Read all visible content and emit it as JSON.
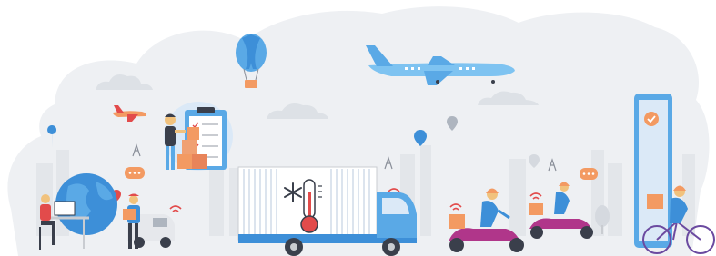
{
  "scene": {
    "kind": "logistics-illustration",
    "palette": {
      "background": "#ffffff",
      "cloud_bg": "#eef0f3",
      "skyline": "#e3e6ea",
      "primary_blue": "#3d8fd8",
      "light_blue": "#5aa9e6",
      "sky_blue": "#7ec3f1",
      "magenta": "#b0368a",
      "purple": "#6b4aa0",
      "orange": "#f39a62",
      "accent_red": "#e24b4b",
      "grey": "#c9ccd1",
      "dark": "#3a3f4b"
    },
    "icons": [
      "hot-air-balloon-icon",
      "airplane-icon",
      "small-airplane-icon",
      "location-pin-icon",
      "wifi-signal-icon",
      "radio-tower-icon",
      "chat-bubble-icon",
      "snowflake-icon",
      "thermometer-icon",
      "checkmark-icon"
    ]
  }
}
